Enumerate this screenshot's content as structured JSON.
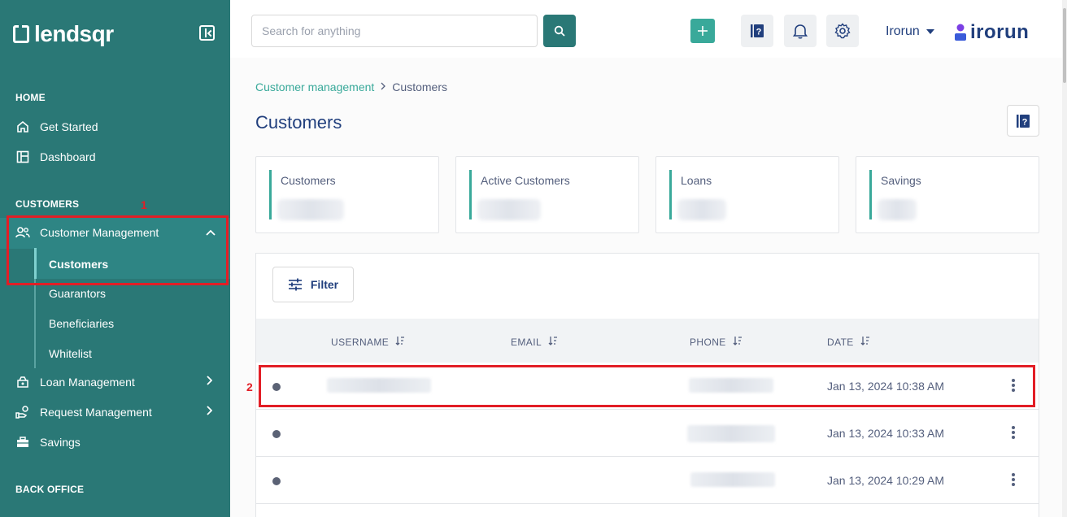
{
  "brand": {
    "logo_text": "lendsqr",
    "org_name": "Irorun",
    "org_logo_text": "irorun"
  },
  "topbar": {
    "search_placeholder": "Search for anything",
    "user": "Irorun"
  },
  "sidebar": {
    "sections": {
      "home": "HOME",
      "customers": "CUSTOMERS",
      "back_office": "BACK OFFICE"
    },
    "items": {
      "get_started": "Get Started",
      "dashboard": "Dashboard",
      "customer_management": "Customer Management",
      "loan_management": "Loan Management",
      "request_management": "Request Management",
      "savings": "Savings"
    },
    "sub_items": [
      "Customers",
      "Guarantors",
      "Beneficiaries",
      "Whitelist"
    ]
  },
  "annotations": {
    "one": "1",
    "two": "2"
  },
  "breadcrumb": {
    "parent": "Customer management",
    "current": "Customers"
  },
  "page": {
    "title": "Customers"
  },
  "stats": [
    {
      "label": "Customers"
    },
    {
      "label": "Active Customers"
    },
    {
      "label": "Loans"
    },
    {
      "label": "Savings"
    }
  ],
  "table": {
    "filter_label": "Filter",
    "columns": [
      "USERNAME",
      "EMAIL",
      "PHONE",
      "DATE"
    ],
    "rows": [
      {
        "date": "Jan 13, 2024 10:38 AM"
      },
      {
        "date": "Jan 13, 2024 10:33 AM"
      },
      {
        "date": "Jan 13, 2024 10:29 AM"
      }
    ]
  },
  "colors": {
    "sidebar": "#2a7876",
    "accent": "#39a99a",
    "text": "#213f7d",
    "highlight": "#e21e26"
  }
}
